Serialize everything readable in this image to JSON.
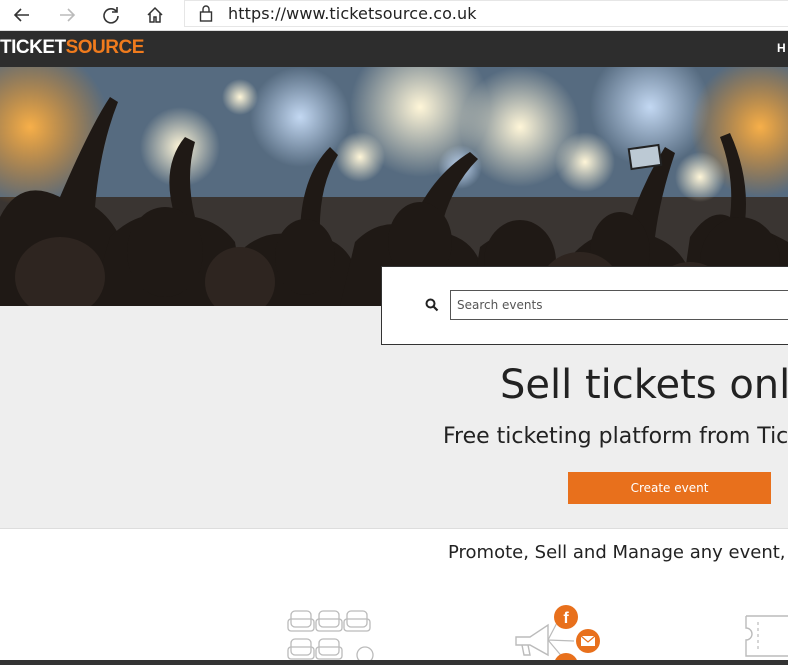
{
  "browser": {
    "url": "https://www.ticketsource.co.uk",
    "icons": [
      "back-arrow-icon",
      "forward-arrow-icon",
      "refresh-icon",
      "home-icon",
      "lock-icon"
    ]
  },
  "header": {
    "logo_part1": "TICKET",
    "logo_part2": "SOURCE",
    "nav_partial": "H"
  },
  "search": {
    "placeholder": "Search events"
  },
  "hero_band": {
    "headline": "Sell tickets onli",
    "subheadline": "Free ticketing platform from Tic",
    "cta_label": "Create event"
  },
  "features": {
    "tagline": "Promote, Sell and Manage any event, i",
    "icons": [
      "seating-chart-icon",
      "social-share-icon",
      "ticket-icon"
    ]
  },
  "colors": {
    "brand_orange": "#e8701c",
    "header_dark": "#2d2d2d",
    "band_grey": "#eeeeee"
  }
}
